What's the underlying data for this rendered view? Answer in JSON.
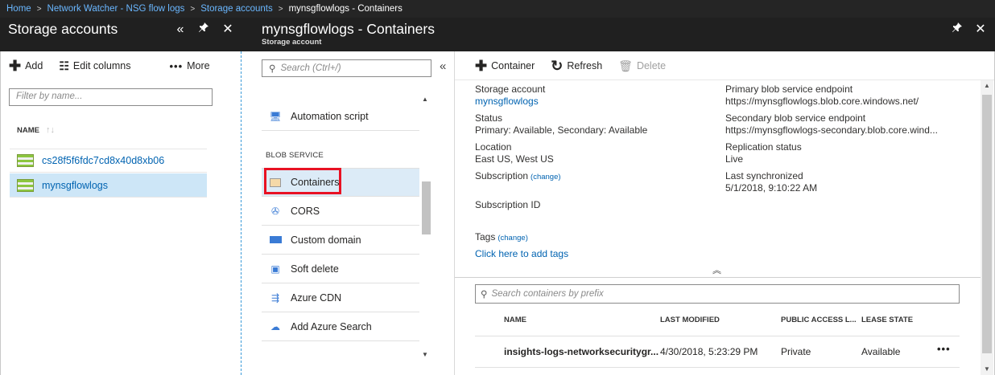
{
  "breadcrumb": {
    "items": [
      "Home",
      "Network Watcher - NSG flow logs",
      "Storage accounts"
    ],
    "current": "mynsgflowlogs - Containers"
  },
  "blade1": {
    "title": "Storage accounts",
    "toolbar": {
      "add": "Add",
      "edit_columns": "Edit columns",
      "more": "More"
    },
    "filter_placeholder": "Filter by name...",
    "column_header": "NAME",
    "accounts": [
      "cs28f5f6fdc7cd8x40d8xb06",
      "mynsgflowlogs"
    ],
    "selected_index": 1
  },
  "blade2": {
    "search_placeholder": "Search (Ctrl+/)",
    "menu_top": "Automation script",
    "section_label": "BLOB SERVICE",
    "menu": [
      "Containers",
      "CORS",
      "Custom domain",
      "Soft delete",
      "Azure CDN",
      "Add Azure Search"
    ],
    "selected": "Containers"
  },
  "blade3": {
    "title": "mynsgflowlogs - Containers",
    "subtitle": "Storage account",
    "toolbar": {
      "container": "Container",
      "refresh": "Refresh",
      "delete": "Delete"
    },
    "essentials": {
      "storage_account_label": "Storage account",
      "storage_account_value": "mynsgflowlogs",
      "status_label": "Status",
      "status_value": "Primary: Available, Secondary: Available",
      "location_label": "Location",
      "location_value": "East US, West US",
      "subscription_label": "Subscription",
      "change": "(change)",
      "subscription_id_label": "Subscription ID",
      "tags_label": "Tags",
      "tags_link": "Click here to add tags",
      "primary_endpoint_label": "Primary blob service endpoint",
      "primary_endpoint_value": "https://mynsgflowlogs.blob.core.windows.net/",
      "secondary_endpoint_label": "Secondary blob service endpoint",
      "secondary_endpoint_value": "https://mynsgflowlogs-secondary.blob.core.wind...",
      "replication_label": "Replication status",
      "replication_value": "Live",
      "last_sync_label": "Last synchronized",
      "last_sync_value": "5/1/2018, 9:10:22 AM"
    },
    "search_placeholder": "Search containers by prefix",
    "columns": [
      "NAME",
      "LAST MODIFIED",
      "PUBLIC ACCESS L...",
      "LEASE STATE"
    ],
    "rows": [
      {
        "name": "insights-logs-networksecuritygr...",
        "modified": "4/30/2018, 5:23:29 PM",
        "access": "Private",
        "lease": "Available"
      }
    ]
  }
}
